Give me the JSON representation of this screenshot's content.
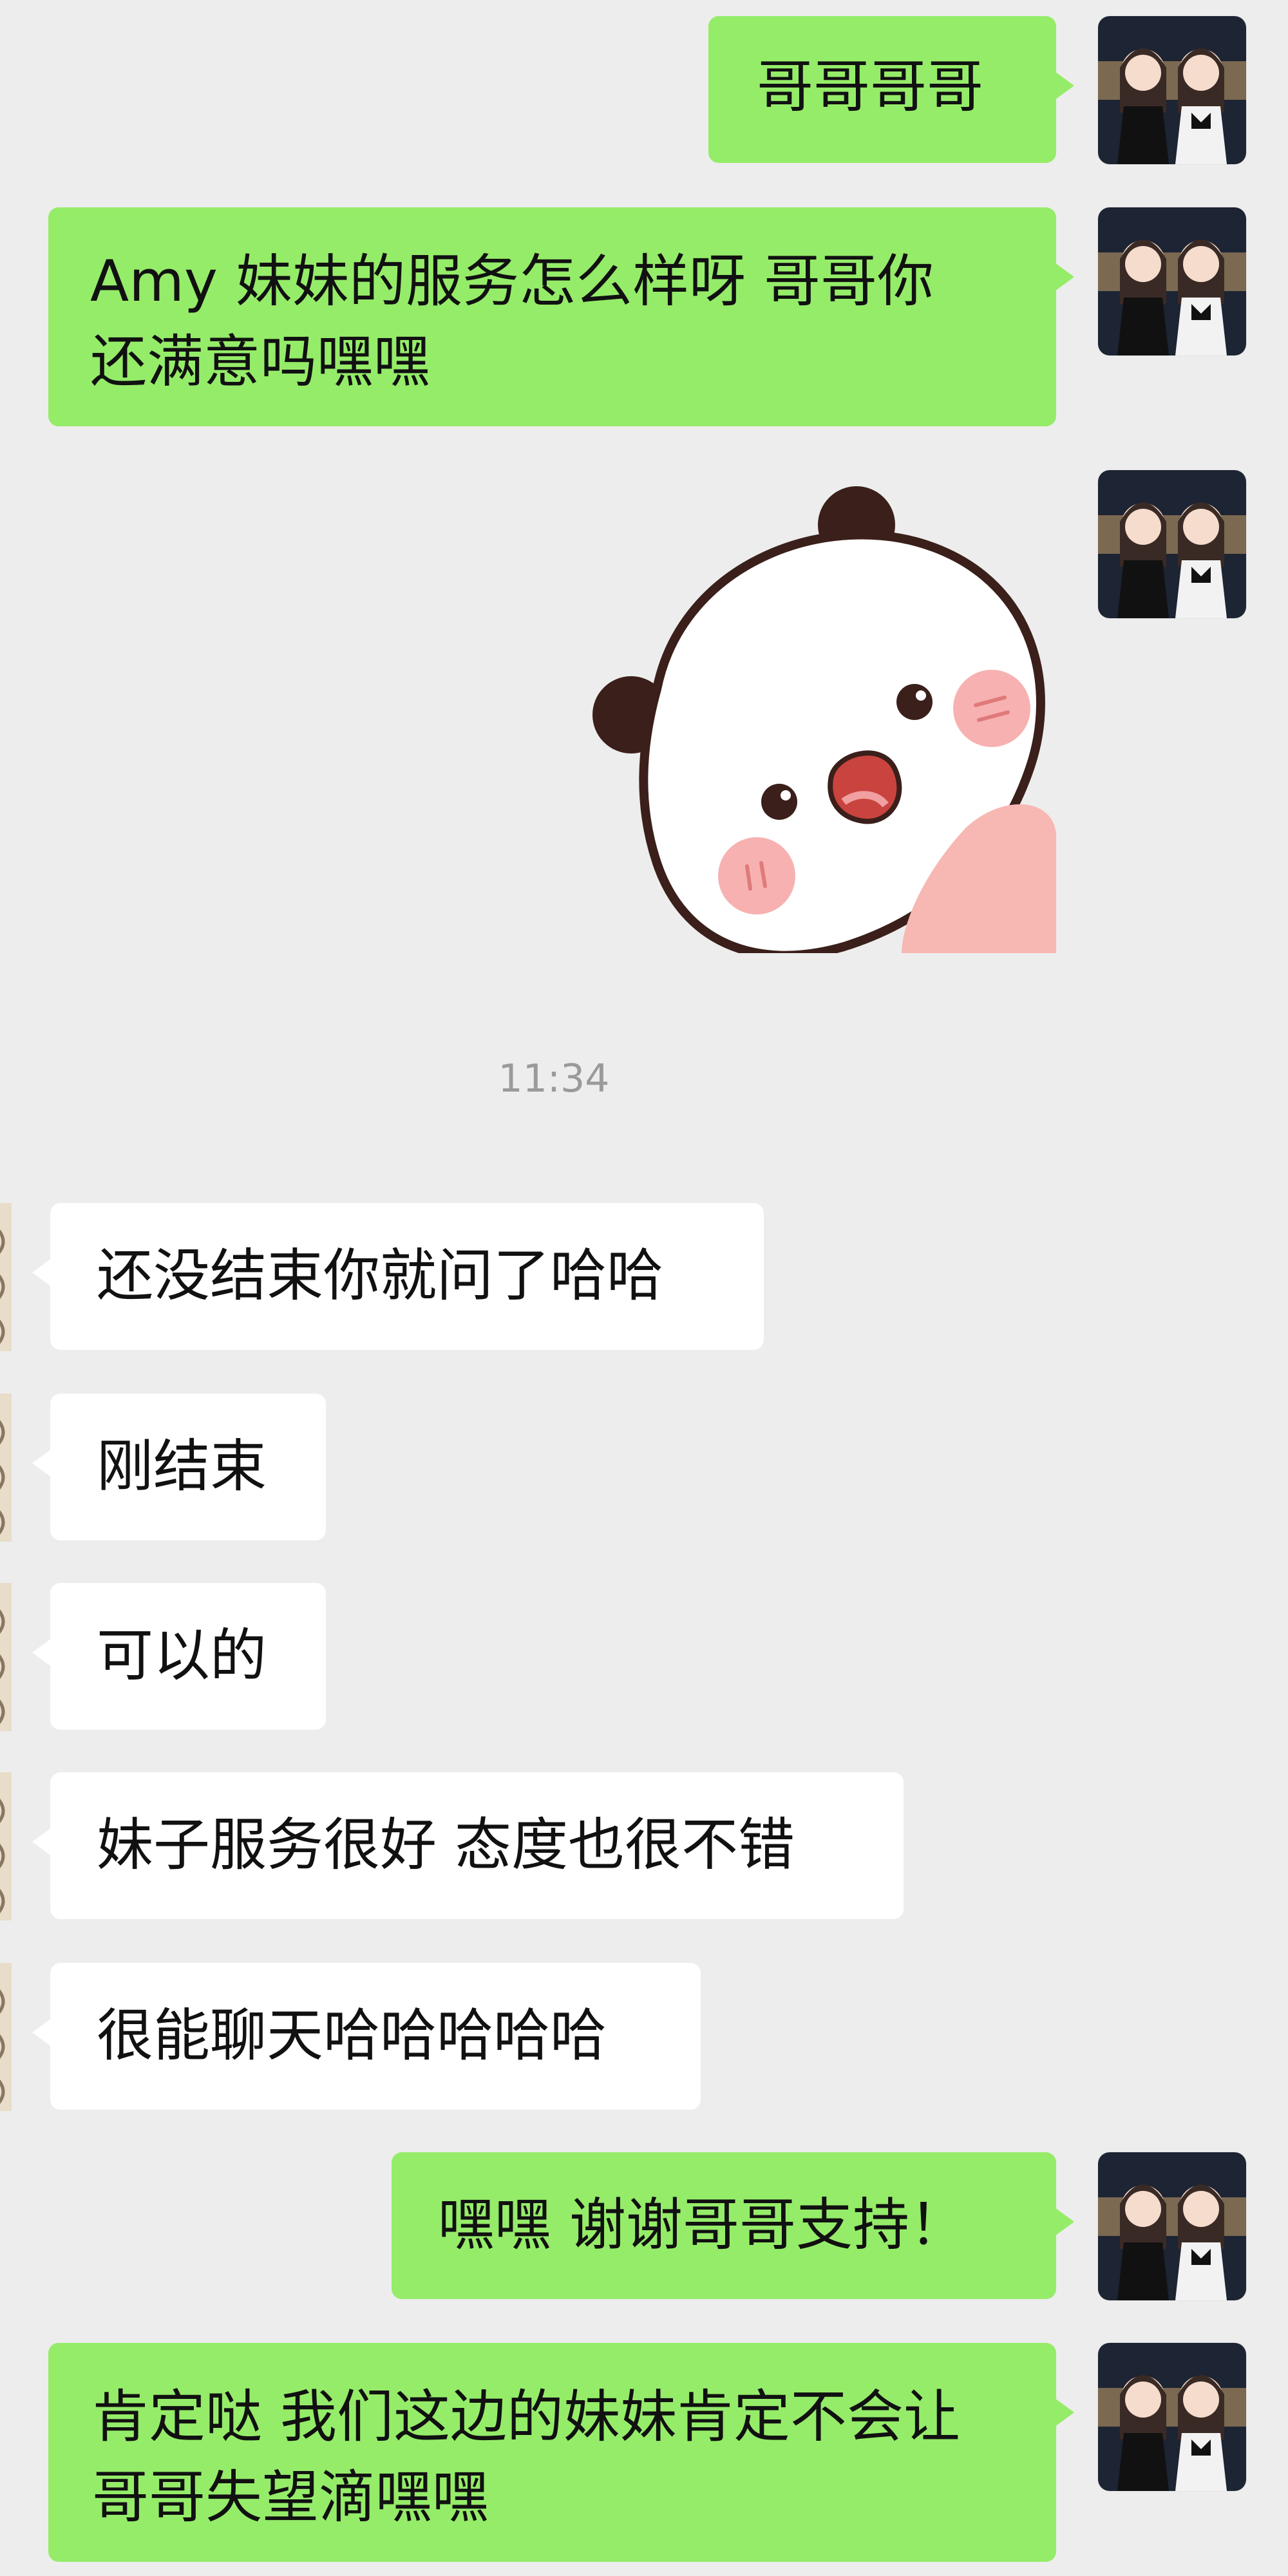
{
  "conversation": {
    "messages": [
      {
        "side": "sent",
        "text": "哥哥哥哥"
      },
      {
        "side": "sent",
        "text": "Amy 妹妹的服务怎么样呀 哥哥你\n还满意吗嘿嘿"
      },
      {
        "side": "sent",
        "type": "sticker",
        "icon": "panda-sticker-icon"
      },
      {
        "side": "recv",
        "text": "还没结束你就问了哈哈"
      },
      {
        "side": "recv",
        "text": "刚结束"
      },
      {
        "side": "recv",
        "text": "可以的"
      },
      {
        "side": "recv",
        "text": "妹子服务很好 态度也很不错"
      },
      {
        "side": "recv",
        "text": "很能聊天哈哈哈哈哈"
      },
      {
        "side": "sent",
        "text": "嘿嘿 谢谢哥哥支持！"
      },
      {
        "side": "sent",
        "text": "肯定哒 我们这边的妹妹肯定不会让\n哥哥失望滴嘿嘿"
      }
    ],
    "timestamp": "11:34"
  },
  "colors": {
    "background": "#ededed",
    "sent_bubble": "#95ec69",
    "received_bubble": "#ffffff",
    "timestamp_text": "#9a9a9a"
  }
}
